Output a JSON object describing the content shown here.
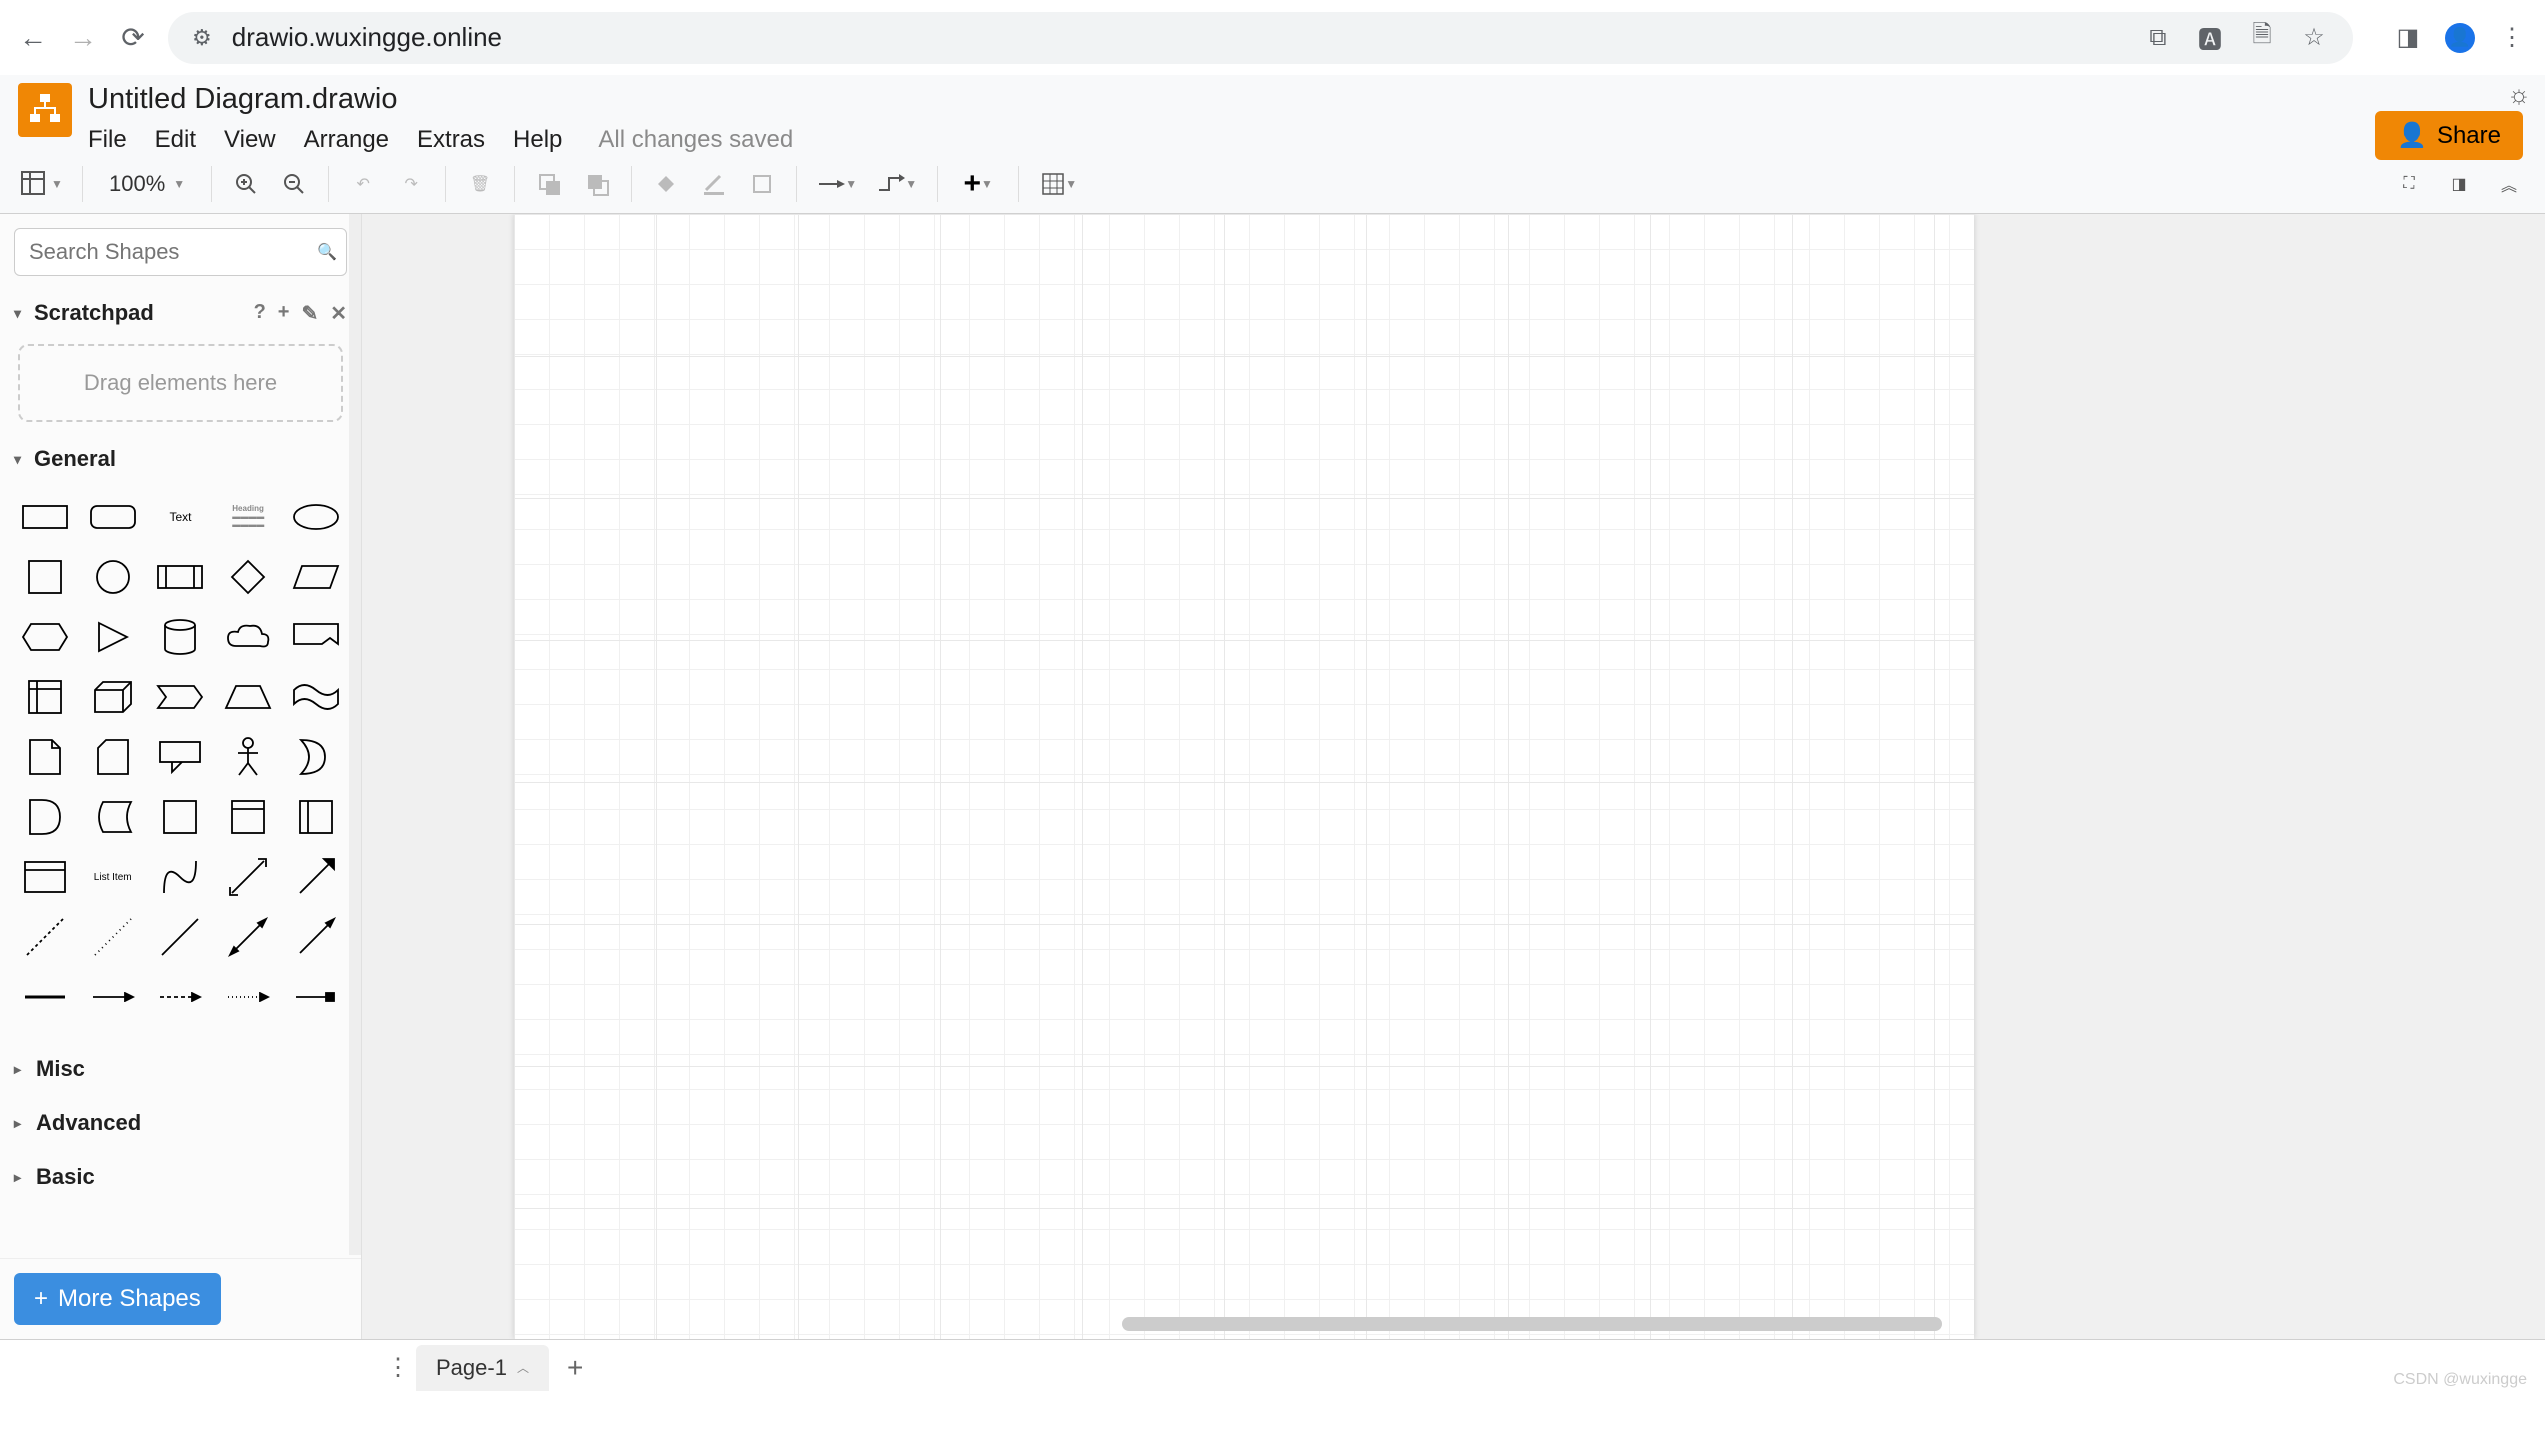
{
  "browser": {
    "url": "drawio.wuxingge.online"
  },
  "header": {
    "doc_title": "Untitled Diagram.drawio",
    "menu": [
      "File",
      "Edit",
      "View",
      "Arrange",
      "Extras",
      "Help"
    ],
    "save_status": "All changes saved",
    "share_label": "Share"
  },
  "toolbar": {
    "zoom": "100%"
  },
  "sidebar": {
    "search_placeholder": "Search Shapes",
    "scratchpad_label": "Scratchpad",
    "scratchpad_drop": "Drag elements here",
    "general_label": "General",
    "text_shape_label": "Text",
    "heading_label": "Heading",
    "list_item_label": "List Item",
    "collapsed": [
      "Misc",
      "Advanced",
      "Basic"
    ],
    "more_shapes": "More Shapes"
  },
  "footer": {
    "page_tab": "Page-1",
    "watermark": "CSDN @wuxingge"
  }
}
